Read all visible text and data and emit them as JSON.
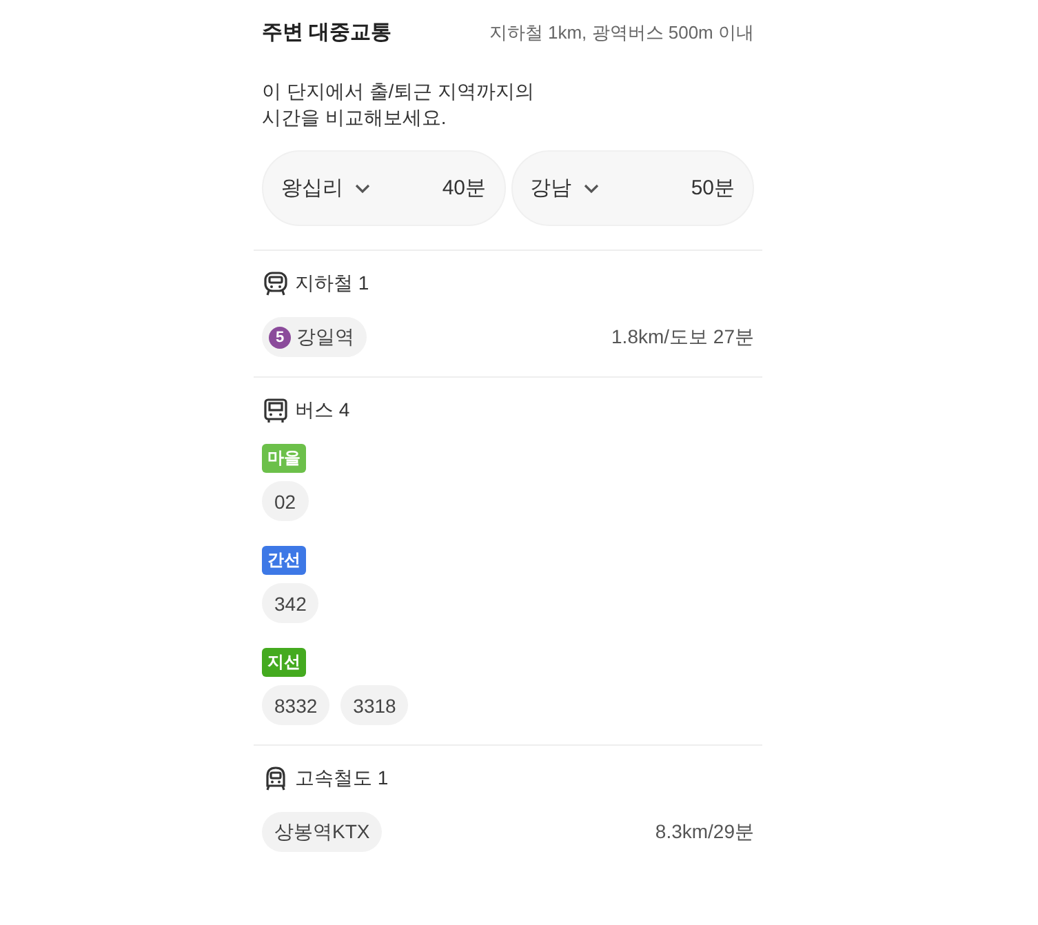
{
  "header": {
    "title": "주변 대중교통",
    "note": "지하철 1km, 광역버스 500m 이내"
  },
  "description": "이 단지에서 출/퇴근 지역까지의\n시간을 비교해보세요.",
  "commutes": [
    {
      "place": "왕십리",
      "time": "40분"
    },
    {
      "place": "강남",
      "time": "50분"
    }
  ],
  "sections": [
    {
      "kind": "subway",
      "title": "지하철 1",
      "stations": [
        {
          "line": "5",
          "color": "#8b4b9b",
          "name": "강일역",
          "distance": "1.8km/도보 27분"
        }
      ]
    },
    {
      "kind": "bus",
      "title": "버스 4",
      "groups": [
        {
          "type": "마을",
          "color": "#6cc04a",
          "routes": [
            "02"
          ]
        },
        {
          "type": "간선",
          "color": "#3d78e6",
          "routes": [
            "342"
          ]
        },
        {
          "type": "지선",
          "color": "#44aa1f",
          "routes": [
            "8332",
            "3318"
          ]
        }
      ]
    },
    {
      "kind": "rail",
      "title": "고속철도 1",
      "stations": [
        {
          "name": "상봉역KTX",
          "distance": "8.3km/29분"
        }
      ]
    }
  ]
}
